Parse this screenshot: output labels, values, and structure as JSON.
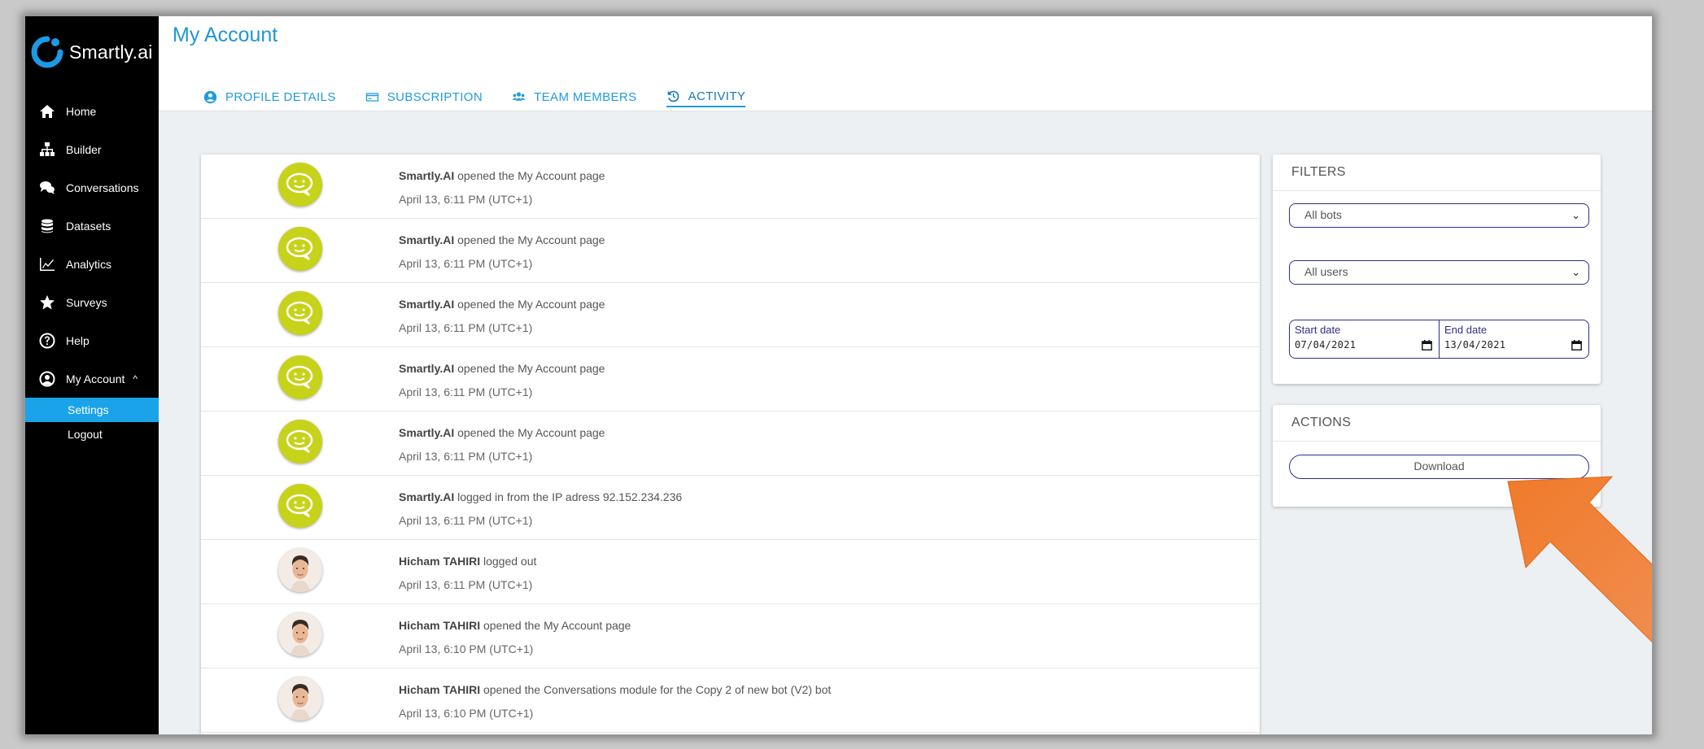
{
  "app": {
    "name": "Smartly.ai"
  },
  "colors": {
    "accent": "#1e9be0",
    "bot_avatar": "#c7d21a",
    "border": "#2b2f8f",
    "arrow": "#f07a2a"
  },
  "sidebar": {
    "items": [
      {
        "label": "Home",
        "icon": "home-icon"
      },
      {
        "label": "Builder",
        "icon": "sitemap-icon"
      },
      {
        "label": "Conversations",
        "icon": "chat-bubbles-icon"
      },
      {
        "label": "Datasets",
        "icon": "database-icon"
      },
      {
        "label": "Analytics",
        "icon": "line-chart-icon"
      },
      {
        "label": "Surveys",
        "icon": "star-icon"
      },
      {
        "label": "Help",
        "icon": "question-circle-icon"
      },
      {
        "label": "My Account",
        "icon": "user-circle-icon",
        "caret": "^"
      }
    ],
    "subitems": [
      {
        "label": "Settings",
        "active": true
      },
      {
        "label": "Logout",
        "active": false
      }
    ]
  },
  "header": {
    "title": "My Account",
    "tabs": [
      {
        "label": "PROFILE DETAILS",
        "icon": "account-circle-icon"
      },
      {
        "label": "SUBSCRIPTION",
        "icon": "credit-card-icon"
      },
      {
        "label": "TEAM MEMBERS",
        "icon": "users-icon"
      },
      {
        "label": "ACTIVITY",
        "icon": "history-icon",
        "active": true
      }
    ]
  },
  "activity": [
    {
      "actor": "Smartly.AI",
      "action": " opened the My Account page",
      "time": "April 13, 6:11 PM (UTC+1)",
      "avatar": "bot"
    },
    {
      "actor": "Smartly.AI",
      "action": " opened the My Account page",
      "time": "April 13, 6:11 PM (UTC+1)",
      "avatar": "bot"
    },
    {
      "actor": "Smartly.AI",
      "action": " opened the My Account page",
      "time": "April 13, 6:11 PM (UTC+1)",
      "avatar": "bot"
    },
    {
      "actor": "Smartly.AI",
      "action": " opened the My Account page",
      "time": "April 13, 6:11 PM (UTC+1)",
      "avatar": "bot"
    },
    {
      "actor": "Smartly.AI",
      "action": " opened the My Account page",
      "time": "April 13, 6:11 PM (UTC+1)",
      "avatar": "bot"
    },
    {
      "actor": "Smartly.AI",
      "action": " logged in from the IP adress 92.152.234.236",
      "time": "April 13, 6:11 PM (UTC+1)",
      "avatar": "bot"
    },
    {
      "actor": "Hicham TAHIRI",
      "action": " logged out",
      "time": "April 13, 6:11 PM (UTC+1)",
      "avatar": "user"
    },
    {
      "actor": "Hicham TAHIRI",
      "action": " opened the My Account page",
      "time": "April 13, 6:10 PM (UTC+1)",
      "avatar": "user"
    },
    {
      "actor": "Hicham TAHIRI",
      "action": " opened the Conversations module for the Copy 2 of new bot (V2) bot",
      "time": "April 13, 6:10 PM (UTC+1)",
      "avatar": "user"
    }
  ],
  "filters": {
    "title": "FILTERS",
    "bots_select": "All bots",
    "users_select": "All users",
    "start_date_label": "Start date",
    "start_date_value": "07/04/2021",
    "end_date_label": "End date",
    "end_date_value": "13/04/2021"
  },
  "actions": {
    "title": "ACTIONS",
    "download_label": "Download"
  }
}
